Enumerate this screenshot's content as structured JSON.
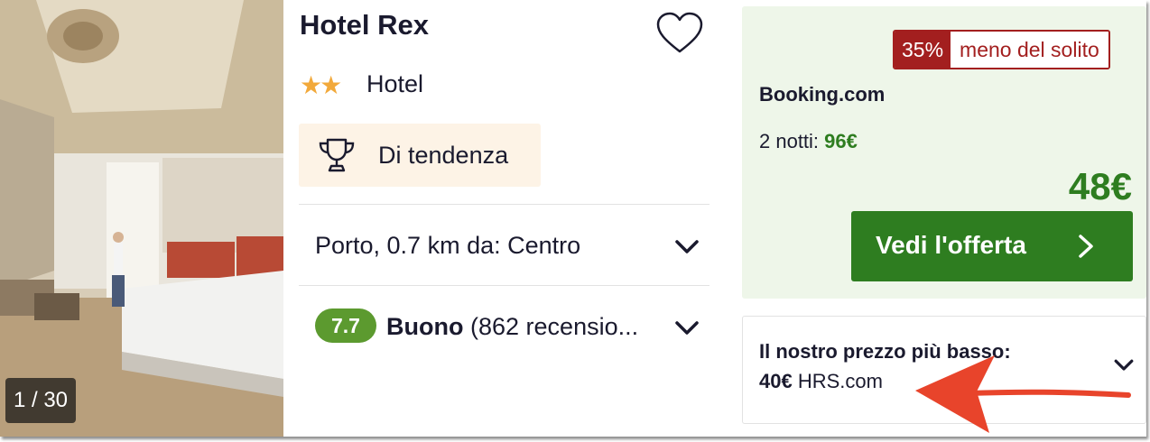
{
  "photo": {
    "counter": "1 / 30"
  },
  "hotel": {
    "name": "Hotel Rex",
    "star_count": 2,
    "stars": "★★",
    "type": "Hotel",
    "badge": "Di tendenza",
    "location": "Porto, 0.7 km da: Centro",
    "rating": {
      "score": "7.7",
      "label": "Buono",
      "reviews": "(862 recensio..."
    }
  },
  "offer": {
    "discount_pct": "35%",
    "discount_text": "meno del solito",
    "provider": "Booking.com",
    "nights_label": "2 notti:",
    "nights_total": "96€",
    "price": "48€",
    "cta": "Vedi l'offerta"
  },
  "lowest": {
    "title": "Il nostro prezzo più basso:",
    "price": "40€",
    "provider": "HRS.com"
  },
  "icons": [
    "heart-icon",
    "star-icon",
    "trophy-icon",
    "chevron-down-icon",
    "chevron-right-icon"
  ],
  "colors": {
    "accent_green": "#2e7d20",
    "discount_red": "#a31f1f",
    "star": "#f2a93b",
    "rating_green": "#5c9a2f",
    "arrow_red": "#e8442b"
  }
}
